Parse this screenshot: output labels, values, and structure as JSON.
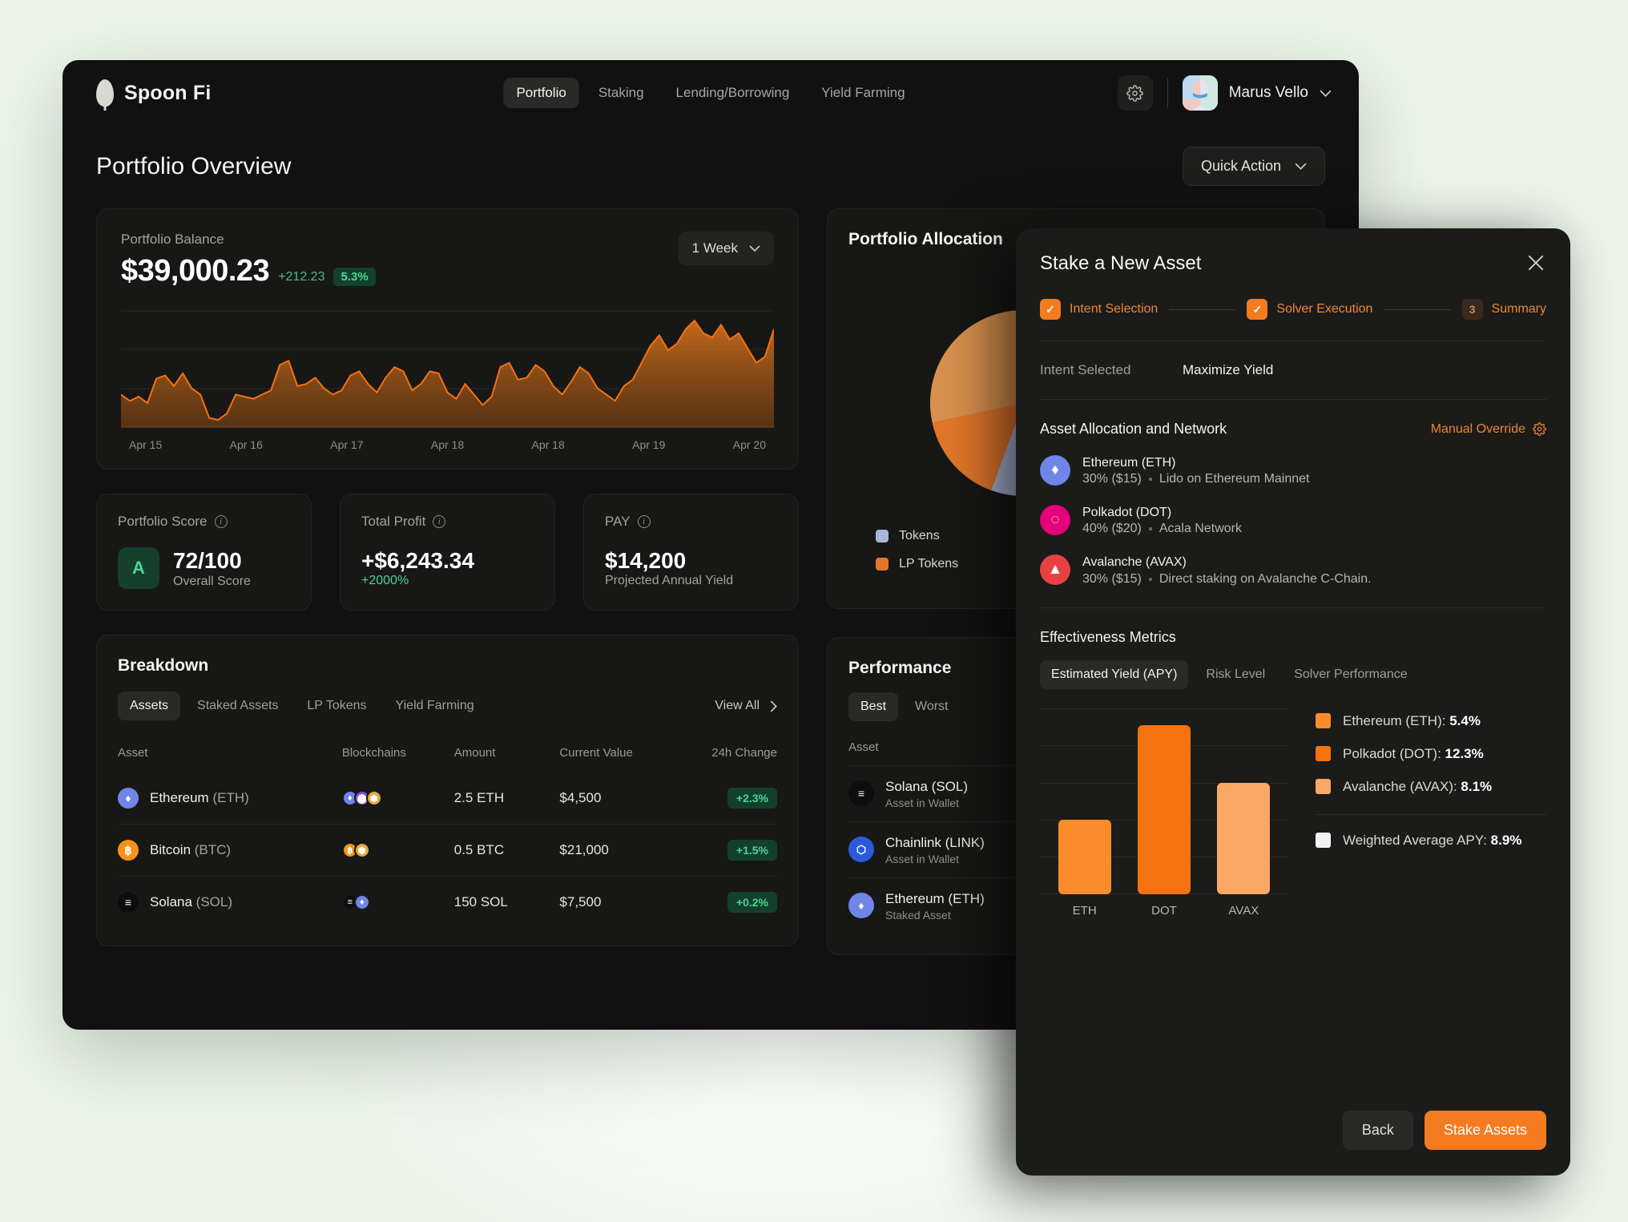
{
  "header": {
    "brand": "Spoon Fi",
    "brand_logo_icon": "spoon-logo-icon",
    "nav": [
      {
        "label": "Portfolio",
        "active": true
      },
      {
        "label": "Staking",
        "active": false
      },
      {
        "label": "Lending/Borrowing",
        "active": false
      },
      {
        "label": "Yield Farming",
        "active": false
      }
    ],
    "settings_icon": "gear-icon",
    "user": {
      "name": "Marus Vello",
      "chevron_icon": "chevron-down-icon",
      "avatar_icon": "user-avatar"
    }
  },
  "page": {
    "title": "Portfolio Overview",
    "quick_action": {
      "label": "Quick Action",
      "chevron_icon": "chevron-down-icon"
    }
  },
  "balance": {
    "label": "Portfolio Balance",
    "amount": "$39,000.23",
    "delta": "+212.23",
    "percent": "5.3%",
    "range": "1 Week",
    "range_chevron_icon": "chevron-down-icon",
    "axis": [
      "Apr 15",
      "Apr 16",
      "Apr 17",
      "Apr 18",
      "Apr 18",
      "Apr 19",
      "Apr 20"
    ]
  },
  "stats": [
    {
      "label": "Portfolio Score",
      "info_icon": "info-icon",
      "grade": "A",
      "value": "72/100",
      "sub": "Overall Score",
      "sub_green": false
    },
    {
      "label": "Total Profit",
      "info_icon": "info-icon",
      "value": "+$6,243.34",
      "sub": "+2000%",
      "sub_green": true
    },
    {
      "label": "PAY",
      "info_icon": "info-icon",
      "value": "$14,200",
      "sub": "Projected Annual Yield",
      "sub_green": false
    }
  ],
  "breakdown": {
    "title": "Breakdown",
    "tabs": [
      {
        "label": "Assets",
        "active": true
      },
      {
        "label": "Staked Assets",
        "active": false
      },
      {
        "label": "LP Tokens",
        "active": false
      },
      {
        "label": "Yield Farming",
        "active": false
      }
    ],
    "view_all": {
      "label": "View All",
      "icon": "chevron-right-icon"
    },
    "columns": [
      "Asset",
      "Blockchains",
      "Amount",
      "Current Value",
      "24h Change"
    ],
    "rows": [
      {
        "name": "Ethereum",
        "symbol": "(ETH)",
        "glyph": "♦",
        "color": "#6f85e8",
        "chains": [
          {
            "glyph": "♦",
            "color": "#6f85e8"
          },
          {
            "glyph": "⬤",
            "color": "#8c4fe0"
          },
          {
            "glyph": "⬢",
            "color": "#e8a93b"
          }
        ],
        "amount": "2.5 ETH",
        "value": "$4,500",
        "change": "+2.3%"
      },
      {
        "name": "Bitcoin",
        "symbol": "(BTC)",
        "glyph": "฿",
        "color": "#f7931a",
        "chains": [
          {
            "glyph": "฿",
            "color": "#f7931a"
          },
          {
            "glyph": "⬢",
            "color": "#e8a93b"
          }
        ],
        "amount": "0.5 BTC",
        "value": "$21,000",
        "change": "+1.5%"
      },
      {
        "name": "Solana",
        "symbol": "(SOL)",
        "glyph": "≡",
        "color": "#0d0d0d",
        "chains": [
          {
            "glyph": "≡",
            "color": "#0d0d0d"
          },
          {
            "glyph": "♦",
            "color": "#6f85e8"
          }
        ],
        "amount": "150 SOL",
        "value": "$7,500",
        "change": "+0.2%"
      }
    ]
  },
  "allocation_panel": {
    "title": "Portfolio Allocation",
    "legend": [
      {
        "label": "Tokens",
        "color": "#aab4d4"
      },
      {
        "label": "LP Tokens",
        "color": "#e2772a"
      }
    ]
  },
  "performance_panel": {
    "title": "Performance",
    "tabs": [
      {
        "label": "Best",
        "active": true
      },
      {
        "label": "Worst",
        "active": false
      }
    ],
    "columns": [
      "Asset"
    ],
    "rows": [
      {
        "name": "Solana (SOL)",
        "sub": "Asset in Wallet",
        "glyph": "≡",
        "color": "#0d0d0d"
      },
      {
        "name": "Chainlink (LINK)",
        "sub": "Asset in Wallet",
        "glyph": "⬡",
        "color": "#2a5ada"
      },
      {
        "name": "Ethereum (ETH)",
        "sub": "Staked Asset",
        "glyph": "♦",
        "color": "#6f85e8"
      }
    ]
  },
  "modal": {
    "title": "Stake a New Asset",
    "close_icon": "close-icon",
    "steps": [
      {
        "label": "Intent Selection",
        "mark": "✓",
        "done": true
      },
      {
        "label": "Solver Execution",
        "mark": "✓",
        "done": true
      },
      {
        "label": "Summary",
        "mark": "3",
        "done": false
      }
    ],
    "intent": {
      "key": "Intent Selected",
      "value": "Maximize Yield"
    },
    "allocation": {
      "title": "Asset Allocation and  Network",
      "manual_override": {
        "label": "Manual Override",
        "icon": "gear-icon"
      },
      "items": [
        {
          "name": "Ethereum (ETH)",
          "alloc": "30% ($15)",
          "network": "Lido on Ethereum Mainnet",
          "glyph": "♦",
          "color": "#6f85e8"
        },
        {
          "name": "Polkadot (DOT)",
          "alloc": "40% ($20)",
          "network": "Acala Network",
          "glyph": "◌",
          "color": "#e6007a"
        },
        {
          "name": "Avalanche (AVAX)",
          "alloc": "30% ($15)",
          "network": "Direct staking on Avalanche C-Chain.",
          "glyph": "▲",
          "color": "#e84142"
        }
      ]
    },
    "effectiveness": {
      "title": "Effectiveness Metrics",
      "tabs": [
        {
          "label": "Estimated Yield (APY)",
          "active": true
        },
        {
          "label": "Risk Level",
          "active": false
        },
        {
          "label": "Solver Performance",
          "active": false
        }
      ],
      "weighted": {
        "label": "Weighted Average APY:",
        "value": "8.9%",
        "color": "#f2f2f2"
      }
    },
    "footer": {
      "back": "Back",
      "stake": "Stake Assets"
    }
  },
  "chart_data": {
    "type": "bar",
    "title": "Estimated Yield (APY)",
    "categories": [
      "ETH",
      "DOT",
      "AVAX"
    ],
    "values": [
      5.4,
      12.3,
      8.1
    ],
    "colors": [
      "#fb8c2b",
      "#f4720f",
      "#f9a866"
    ],
    "legend": [
      {
        "name": "Ethereum (ETH)",
        "value": "5.4%",
        "color": "#fb8c2b"
      },
      {
        "name": "Polkadot (DOT)",
        "value": "12.3%",
        "color": "#f4720f"
      },
      {
        "name": "Avalanche (AVAX)",
        "value": "8.1%",
        "color": "#f9a866"
      }
    ],
    "ylim": [
      0,
      13.5
    ],
    "ylabel": "",
    "xlabel": "",
    "grid": true,
    "legend_position": "right"
  },
  "balance_chart": {
    "type": "area",
    "title": "Portfolio Balance",
    "x": [
      "Apr 15",
      "Apr 16",
      "Apr 17",
      "Apr 18",
      "Apr 18",
      "Apr 19",
      "Apr 20"
    ],
    "ylim": [
      0,
      100
    ],
    "grid": true,
    "color": "#f4720f",
    "values": [
      30,
      24,
      28,
      22,
      45,
      48,
      38,
      50,
      36,
      30,
      8,
      6,
      12,
      30,
      28,
      26,
      30,
      34,
      58,
      62,
      38,
      40,
      46,
      36,
      30,
      34,
      48,
      52,
      40,
      32,
      46,
      56,
      52,
      34,
      40,
      52,
      50,
      32,
      26,
      40,
      30,
      20,
      28,
      56,
      60,
      44,
      46,
      58,
      52,
      38,
      30,
      42,
      56,
      50,
      36,
      30,
      24,
      38,
      44,
      60,
      76,
      86,
      72,
      78,
      92,
      100,
      88,
      84,
      96,
      82,
      88,
      74,
      60,
      66,
      92
    ]
  }
}
